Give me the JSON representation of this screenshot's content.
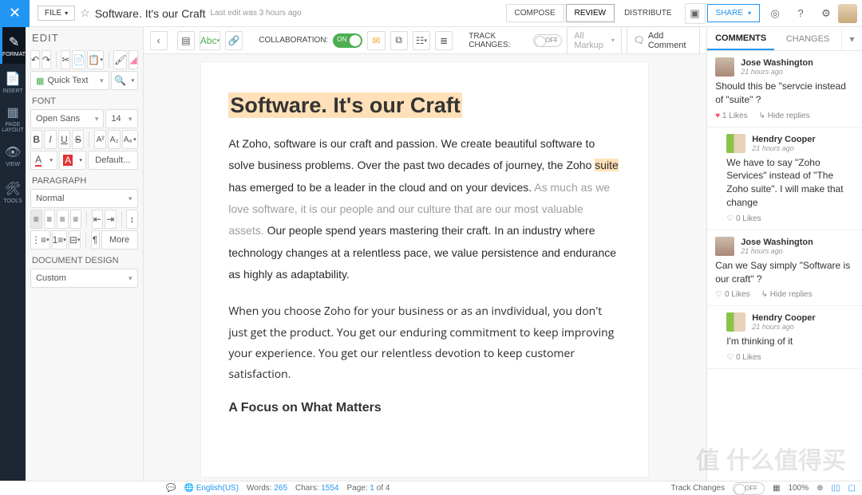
{
  "header": {
    "file_label": "FILE",
    "doc_title": "Software. It's our Craft",
    "doc_sub": "Last edit was 3 hours ago",
    "actions": {
      "compose": "COMPOSE",
      "review": "REVIEW",
      "distribute": "DISTRIBUTE",
      "share": "SHARE"
    }
  },
  "rail": [
    {
      "icon": "✎",
      "label": "FORMAT"
    },
    {
      "icon": "📄",
      "label": "INSERT"
    },
    {
      "icon": "▦",
      "label": "PAGE LAYOUT"
    },
    {
      "icon": "👁",
      "label": "VIEW"
    },
    {
      "icon": "🛠",
      "label": "TOOLS"
    }
  ],
  "sidebar": {
    "title": "EDIT",
    "quick_text": "Quick Text",
    "font_section": "FONT",
    "font_family": "Open Sans",
    "font_size": "14",
    "default_btn": "Default...",
    "paragraph_section": "PARAGRAPH",
    "paragraph_style": "Normal",
    "more_btn": "More",
    "design_section": "DOCUMENT DESIGN",
    "design_value": "Custom"
  },
  "ribbon": {
    "collaboration_label": "COLLABORATION:",
    "track_label": "TRACK CHANGES:",
    "track_off": "OFF",
    "markup": "All Markup",
    "add_comment": "Add Comment"
  },
  "document": {
    "title": "Software. It's our Craft",
    "p1a": "At Zoho, software is our craft and passion. We create beautiful software to solve business problems. Over the past two decades of  journey, the Zoho ",
    "p1_hl": "suite",
    "p1b": " has emerged to be a leader in the cloud and on your devices.   ",
    "p1_strike": "As much as we love software, it is our people and our culture that are our most valuable assets.",
    "p1c": "   Our people spend years mastering their  craft. In an industry where technology changes at a relentless pace, we value persistence and endurance as highly as adaptability.",
    "p2": "When you choose Zoho for your business  or as an invdividual, you don't just get the product. You get our enduring commitment to keep improving your experience.  You get our relentless devotion to keep customer satisfaction.",
    "h2": "A Focus on What Matters"
  },
  "panel": {
    "tabs": {
      "comments": "COMMENTS",
      "changes": "CHANGES"
    },
    "comments": [
      {
        "name": "Jose Washington",
        "time": "21 hours ago",
        "text": "Should this be \"servcie instead of \"suite\" ?",
        "likes": "1 Likes",
        "hide": "Hide replies",
        "hearted": true
      },
      {
        "name": "Hendry Cooper",
        "time": "21 hours ago",
        "text": "We have to say \"Zoho Services\" instead of \"The Zoho suite\". I will make that change",
        "likes": "0 Likes",
        "reply": true
      },
      {
        "name": "Jose Washington",
        "time": "21 hours ago",
        "text": "Can we Say simply \"Software is our craft\" ?",
        "likes": "0 Likes",
        "hide": "Hide replies"
      },
      {
        "name": "Hendry Cooper",
        "time": "21 hours ago",
        "text": "I'm thinking of it",
        "likes": "0 Likes",
        "reply": true
      }
    ]
  },
  "status": {
    "lang": "English(US)",
    "words_lbl": "Words:",
    "words": "265",
    "chars_lbl": "Chars:",
    "chars": "1554",
    "page_lbl": "Page:",
    "page_cur": "1",
    "page_of": "of 4",
    "track_lbl": "Track Changes",
    "track_val": "OFF",
    "zoom": "100%"
  }
}
